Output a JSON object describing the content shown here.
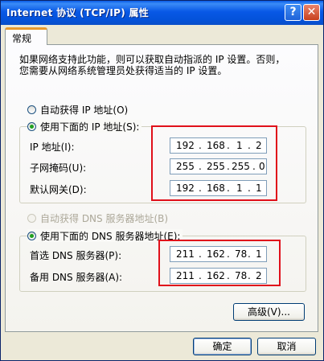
{
  "window": {
    "title": "Internet 协议 (TCP/IP) 属性",
    "help_glyph": "?",
    "close_glyph": "✕"
  },
  "tabs": [
    {
      "label": "常规"
    }
  ],
  "description": {
    "line1": "如果网络支持此功能，则可以获取自动指派的 IP 设置。否则，",
    "line2": "您需要从网络系统管理员处获得适当的 IP 设置。"
  },
  "ip": {
    "auto_label": "自动获得 IP 地址(O)",
    "manual_label": "使用下面的 IP 地址(S):",
    "selected": "manual",
    "address_label": "IP 地址(I):",
    "address": [
      "192",
      "168",
      "1",
      "2"
    ],
    "mask_label": "子网掩码(U):",
    "mask": [
      "255",
      "255",
      "255",
      "0"
    ],
    "gateway_label": "默认网关(D):",
    "gateway": [
      "192",
      "168",
      "1",
      "1"
    ]
  },
  "dns": {
    "auto_label": "自动获得 DNS 服务器地址(B)",
    "auto_disabled": true,
    "manual_label": "使用下面的 DNS 服务器地址(E):",
    "selected": "manual",
    "preferred_label": "首选 DNS 服务器(P):",
    "preferred": [
      "211",
      "162",
      "78",
      "1"
    ],
    "alternate_label": "备用 DNS 服务器(A):",
    "alternate": [
      "211",
      "162",
      "78",
      "2"
    ]
  },
  "buttons": {
    "advanced": "高级(V)...",
    "ok": "确定",
    "cancel": "取消"
  },
  "colors": {
    "highlight_box": "#e0101a",
    "title_bar": "#0a5ce7"
  }
}
